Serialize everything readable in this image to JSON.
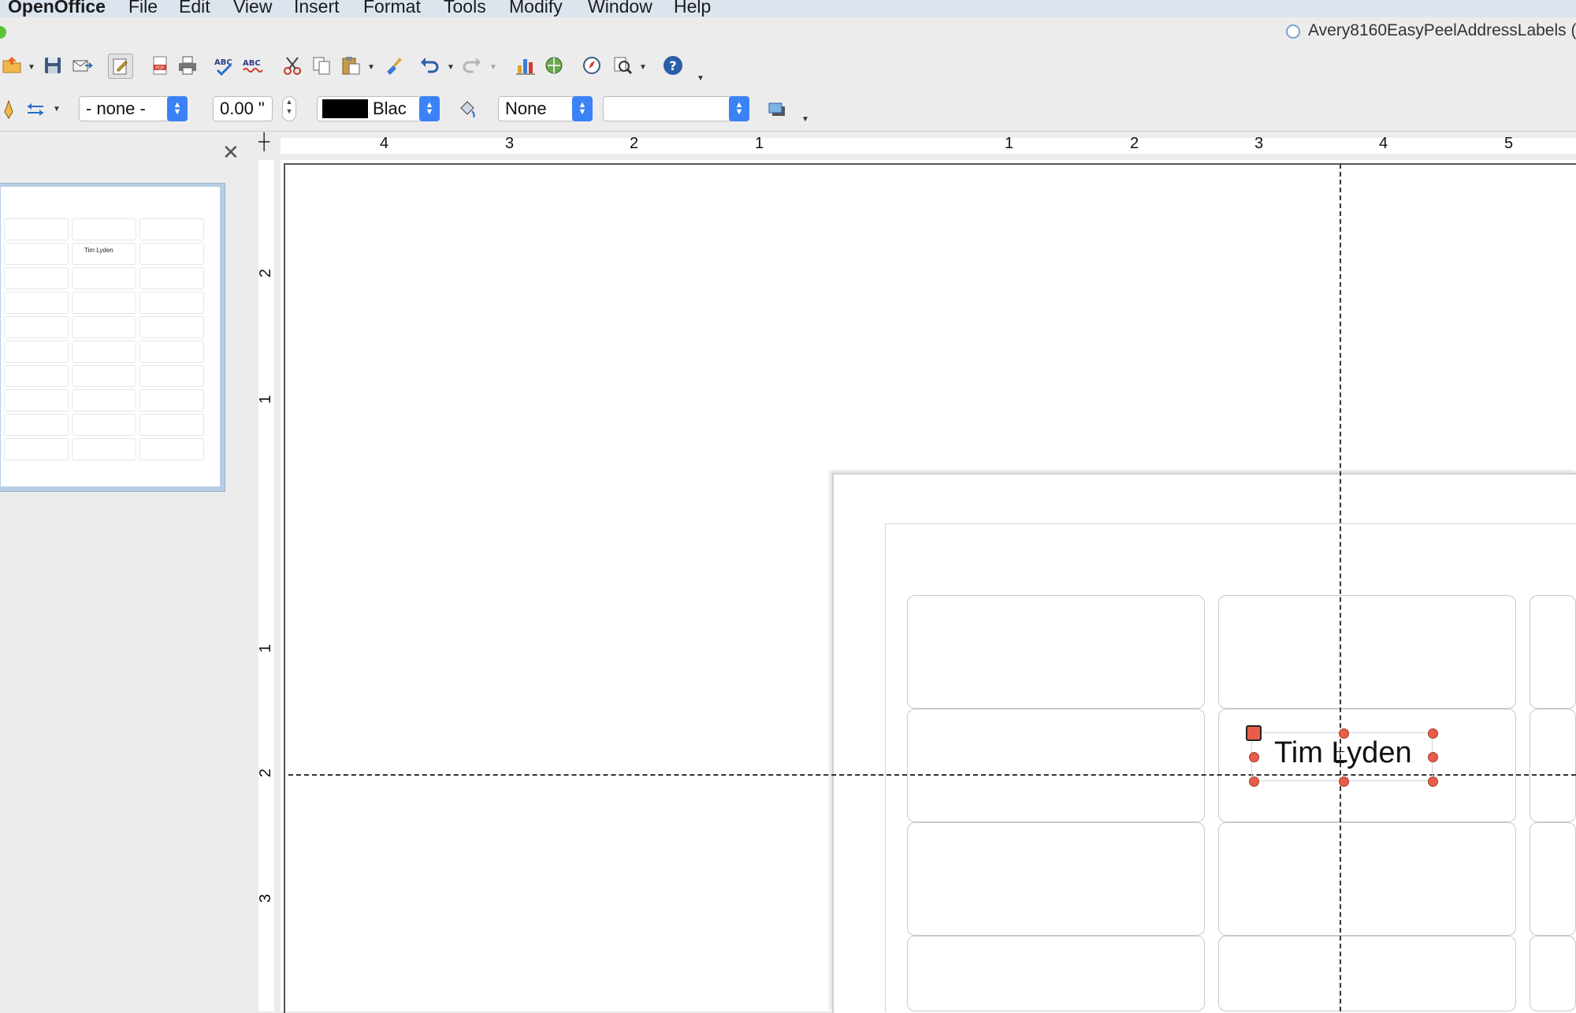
{
  "menubar": {
    "app": "OpenOffice",
    "items": [
      "File",
      "Edit",
      "View",
      "Insert",
      "Format",
      "Tools",
      "Modify",
      "Window",
      "Help"
    ]
  },
  "window": {
    "title": "Avery8160EasyPeelAddressLabels ("
  },
  "toolbar_standard": {
    "icons": [
      "open-icon",
      "save-icon",
      "email-icon",
      "edit-file-icon",
      "export-pdf-icon",
      "print-icon",
      "spellcheck-icon",
      "autospellcheck-icon",
      "cut-icon",
      "copy-icon",
      "paste-icon",
      "clone-format-icon",
      "undo-icon",
      "redo-icon",
      "chart-icon",
      "gallery-icon",
      "navigator-icon",
      "zoom-icon",
      "help-icon"
    ]
  },
  "toolbar_line_fill": {
    "line_style": "- none -",
    "line_width": "0.00 \"",
    "line_color": "Blac",
    "line_color_hex": "#000000",
    "area_style": "None",
    "area_value": ""
  },
  "rulers": {
    "horizontal": [
      "4",
      "3",
      "2",
      "1",
      "1",
      "2",
      "3",
      "4",
      "5"
    ],
    "vertical": [
      "2",
      "1",
      "1",
      "2",
      "3"
    ]
  },
  "slide_panel": {
    "thumbnail_text": "Tim  Lyden"
  },
  "document": {
    "selected_text": "Tim Lyden"
  },
  "colors": {
    "accent": "#3b82f6",
    "handle": "#e85d4a",
    "traffic_green": "#5bc236"
  }
}
